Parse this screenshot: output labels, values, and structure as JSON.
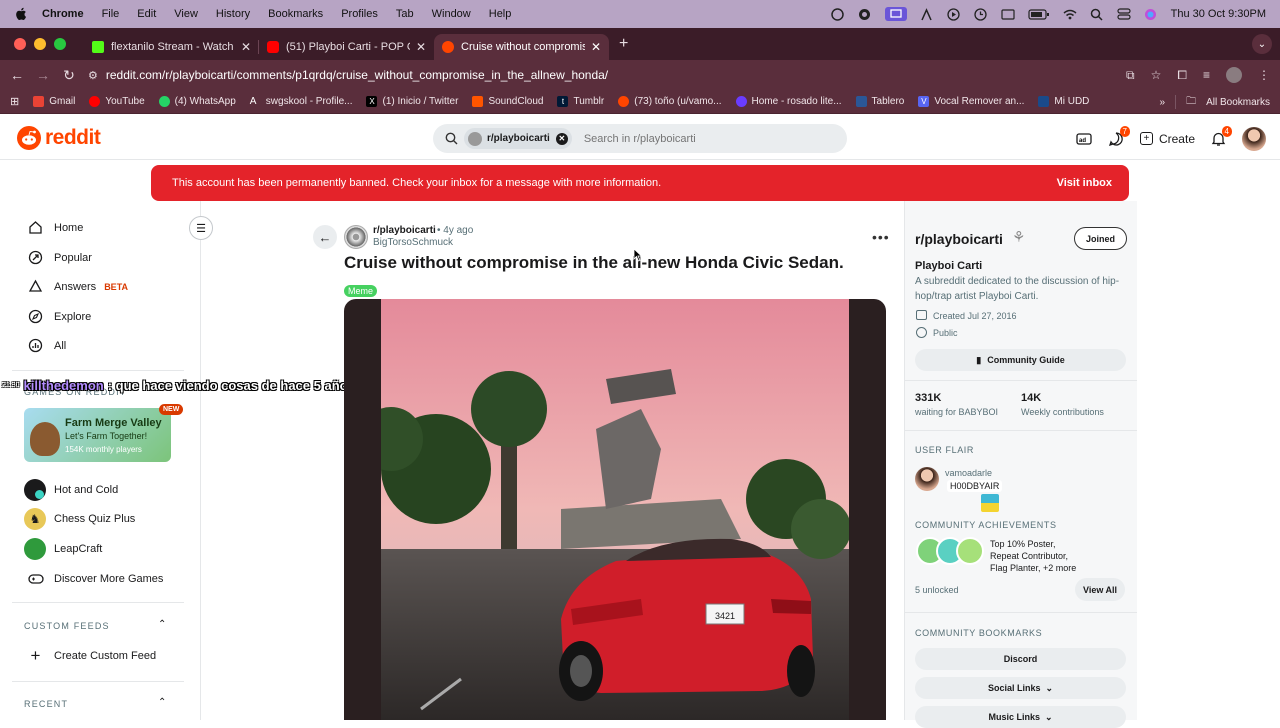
{
  "menubar": {
    "app": "Chrome",
    "items": [
      "File",
      "Edit",
      "View",
      "History",
      "Bookmarks",
      "Profiles",
      "Tab",
      "Window",
      "Help"
    ],
    "datetime": "Thu 30 Oct  9:30PM"
  },
  "tabs": [
    {
      "title": "flextanilo Stream - Watch Live",
      "fav_color": "#53fc18"
    },
    {
      "title": "(51) Playboi Carti - POP OUT",
      "fav_color": "#ff0000"
    },
    {
      "title": "Cruise without compromise in",
      "fav_color": "#ff4500",
      "active": true
    }
  ],
  "address": {
    "url": "reddit.com/r/playboicarti/comments/p1qrdq/cruise_without_compromise_in_the_allnew_honda/"
  },
  "bookmarks": [
    {
      "label": "Gmail",
      "color": "#ea4335"
    },
    {
      "label": "YouTube",
      "color": "#ff0000"
    },
    {
      "label": "(4) WhatsApp",
      "color": "#25d366"
    },
    {
      "label": "swgskool - Profile...",
      "color": "#ffffff"
    },
    {
      "label": "(1) Inicio / Twitter",
      "color": "#000000"
    },
    {
      "label": "SoundCloud",
      "color": "#ff5500"
    },
    {
      "label": "Tumblr",
      "color": "#001935"
    },
    {
      "label": "(73) toño (u/vamo...",
      "color": "#ff4500"
    },
    {
      "label": "Home - rosado lite...",
      "color": "#6a3cff"
    },
    {
      "label": "Tablero",
      "color": "#2b5797"
    },
    {
      "label": "Vocal Remover an...",
      "color": "#5865f2"
    },
    {
      "label": "Mi UDD",
      "color": "#1a4a8a"
    }
  ],
  "bookmarks_right": "All Bookmarks",
  "header": {
    "logo": "reddit",
    "search_chip": "r/playboicarti",
    "search_placeholder": "Search in r/playboicarti",
    "create": "Create",
    "chat_badge": "7",
    "notif_badge": "4"
  },
  "ban": {
    "message": "This account has been permanently banned. Check your inbox for a message with more information.",
    "action": "Visit inbox"
  },
  "sidebar": {
    "items": [
      {
        "label": "Home"
      },
      {
        "label": "Popular"
      },
      {
        "label": "Answers",
        "tag": "BETA"
      },
      {
        "label": "Explore"
      },
      {
        "label": "All"
      }
    ],
    "games_head": "GAMES ON REDDIT",
    "featured_game": {
      "title": "Farm Merge Valley",
      "subtitle": "Let's Farm Together!",
      "players": "154K monthly players",
      "tag": "NEW"
    },
    "games": [
      "Hot and Cold",
      "Chess Quiz Plus",
      "LeapCraft",
      "Discover More Games"
    ],
    "custom_head": "CUSTOM FEEDS",
    "create_feed": "Create Custom Feed",
    "recent_head": "RECENT"
  },
  "overlay_chat": {
    "time": "21:30",
    "user": "killthedemon",
    "text": ": que hace viendo cosas de hace 5 años"
  },
  "post": {
    "subreddit": "r/playboicarti",
    "age": "• 4y ago",
    "author": "BigTorsoSchmuck",
    "title": "Cruise without compromise in the all-new Honda Civic Sedan.",
    "flair": "Meme",
    "plate": "3421"
  },
  "community": {
    "name": "r/playboicarti",
    "joined": "Joined",
    "title": "Playboi Carti",
    "description": "A subreddit dedicated to the discussion of hip-hop/trap artist Playboi Carti.",
    "created": "Created Jul 27, 2016",
    "visibility": "Public",
    "guide": "Community Guide",
    "members": "331K",
    "members_label": "waiting for BABYBOI",
    "contributions": "14K",
    "contributions_label": "Weekly contributions",
    "user_flair_head": "USER FLAIR",
    "flair_user": "vamoadarle",
    "flair_text": "H00DBYAIR",
    "achievements_head": "COMMUNITY ACHIEVEMENTS",
    "achievements": [
      "Top 10% Poster,",
      "Repeat Contributor,",
      "Flag Planter, +2 more"
    ],
    "unlocked": "5 unlocked",
    "view_all": "View All",
    "bookmarks_head": "COMMUNITY BOOKMARKS",
    "bookmarks": [
      "Discord",
      "Social Links",
      "Music Links"
    ]
  }
}
